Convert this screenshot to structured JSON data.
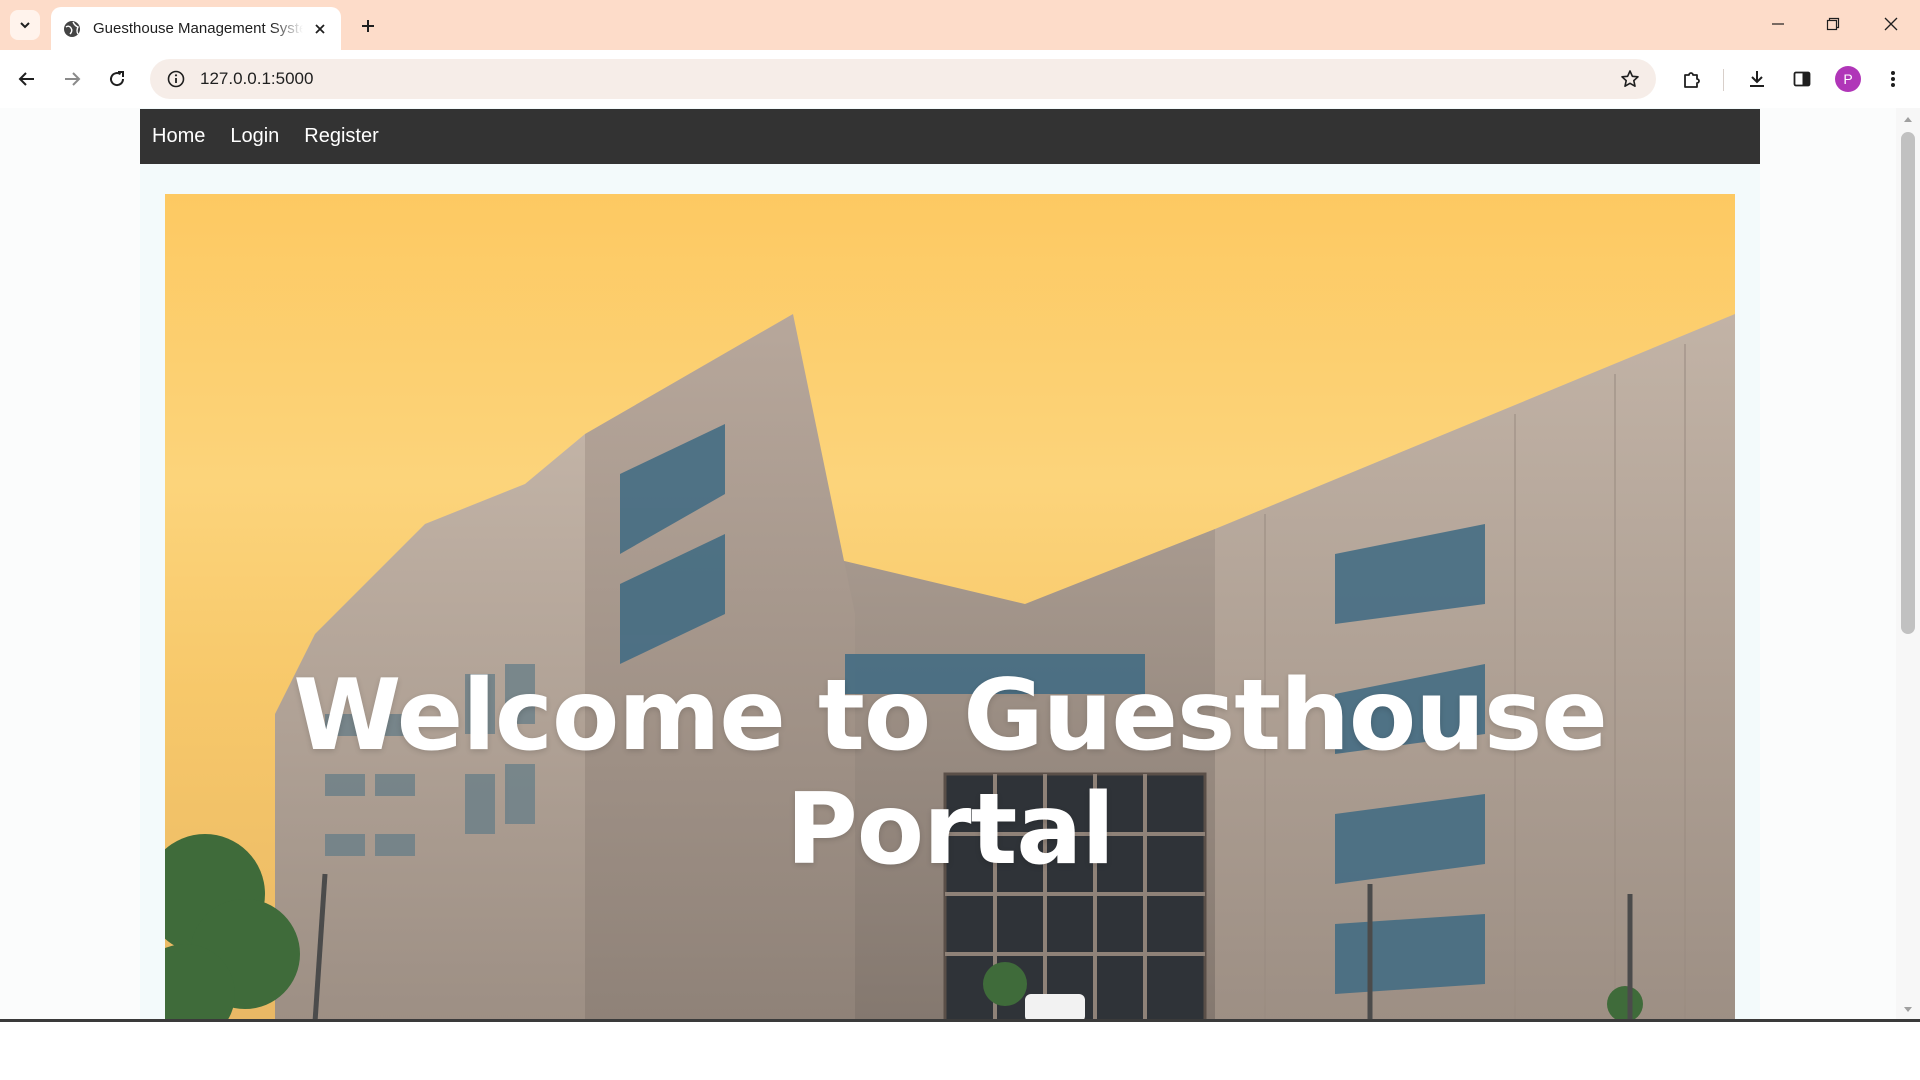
{
  "browser": {
    "tab_title": "Guesthouse Management System",
    "url": "127.0.0.1:5000",
    "profile_initial": "P"
  },
  "navbar": {
    "links": [
      {
        "label": "Home"
      },
      {
        "label": "Login"
      },
      {
        "label": "Register"
      }
    ]
  },
  "hero": {
    "title": "Welcome to Guesthouse Portal"
  },
  "colors": {
    "navbar_bg": "#333333",
    "tabstrip_bg": "#fddcc9",
    "sky": "#fdc962",
    "avatar": "#b036b8"
  }
}
